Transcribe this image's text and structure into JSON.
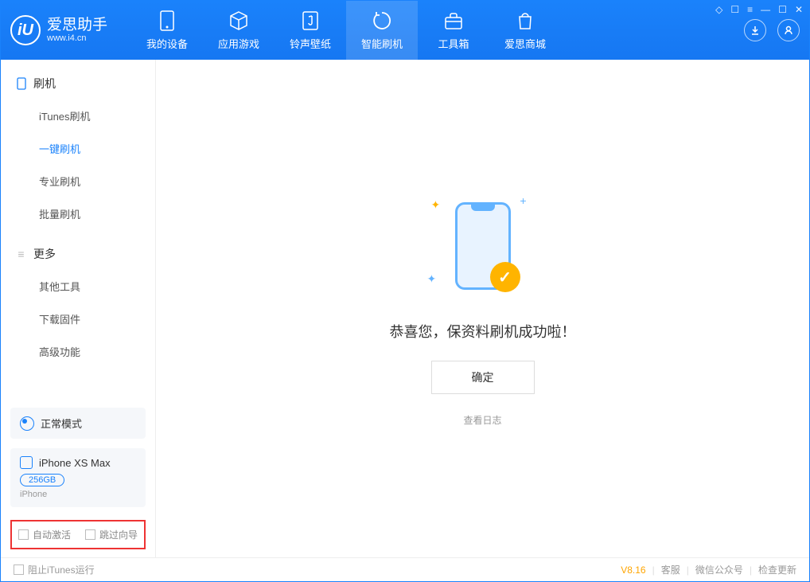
{
  "app": {
    "name_cn": "爱思助手",
    "name_en": "www.i4.cn",
    "logo_letter": "iU"
  },
  "nav": {
    "items": [
      {
        "label": "我的设备"
      },
      {
        "label": "应用游戏"
      },
      {
        "label": "铃声壁纸"
      },
      {
        "label": "智能刷机"
      },
      {
        "label": "工具箱"
      },
      {
        "label": "爱思商城"
      }
    ]
  },
  "sidebar": {
    "section1": {
      "title": "刷机",
      "items": [
        "iTunes刷机",
        "一键刷机",
        "专业刷机",
        "批量刷机"
      ]
    },
    "section2": {
      "title": "更多",
      "items": [
        "其他工具",
        "下载固件",
        "高级功能"
      ]
    },
    "mode": {
      "label": "正常模式"
    },
    "device": {
      "name": "iPhone XS Max",
      "capacity": "256GB",
      "type": "iPhone"
    },
    "checkboxes": {
      "auto_activate": "自动激活",
      "skip_guide": "跳过向导"
    }
  },
  "main": {
    "success_message": "恭喜您，保资料刷机成功啦！",
    "confirm": "确定",
    "view_log": "查看日志"
  },
  "footer": {
    "block_itunes": "阻止iTunes运行",
    "version": "V8.16",
    "links": [
      "客服",
      "微信公众号",
      "检查更新"
    ]
  }
}
